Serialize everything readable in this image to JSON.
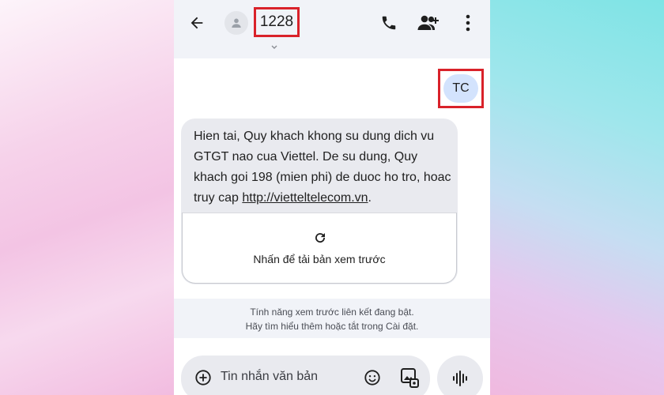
{
  "header": {
    "title": "1228",
    "icons": [
      "arrow-back-icon",
      "person-icon",
      "phone-icon",
      "add-person-icon",
      "more-vert-icon"
    ]
  },
  "messages": {
    "outgoing": {
      "text": "TC"
    },
    "incoming": {
      "text": "Hien tai, Quy khach khong su dung dich vu GTGT nao cua Viettel. De su dung, Quy khach goi 198 (mien phi) de duoc ho tro, hoac truy cap ",
      "link": "http://vietteltelecom.vn",
      "suffix": ".",
      "preview_label": "Nhấn để tải bản xem trước"
    }
  },
  "notice": {
    "line1": "Tính năng xem trước liên kết đang bật.",
    "line2": "Hãy tìm hiểu thêm hoặc tắt trong Cài đặt."
  },
  "composer": {
    "placeholder": "Tin nhắn văn bản"
  },
  "colors": {
    "highlight": "#d9222a",
    "outgoing_bubble": "#d3e3fd",
    "incoming_bubble": "#e9eaef",
    "header_bg": "#f1f3f8"
  }
}
